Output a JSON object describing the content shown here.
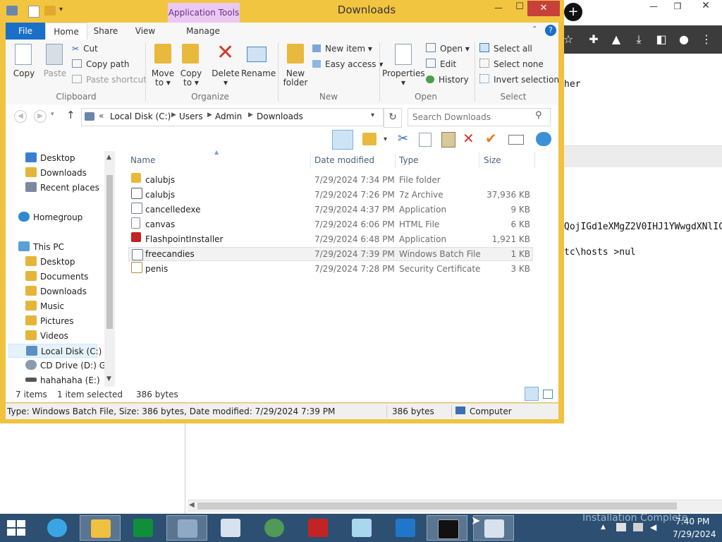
{
  "browser": {
    "code_lines": [
      "her",
      "QojIGd1eXMgZ2V0IHJ1YWwgdXNlIC",
      "tc\\hosts >nul"
    ]
  },
  "window": {
    "title": "Downloads",
    "context_tab": "Application Tools",
    "controls": {
      "minimize": "—",
      "maximize": "☐",
      "close": "✕"
    },
    "accent": "#f2c541"
  },
  "ribbon": {
    "tabs": [
      "File",
      "Home",
      "Share",
      "View",
      "Manage"
    ],
    "clipboard": {
      "copy": "Copy",
      "paste": "Paste",
      "cut": "Cut",
      "copy_path": "Copy path",
      "paste_shortcut": "Paste shortcut",
      "label": "Clipboard"
    },
    "organize": {
      "move_to": "Move\nto ▾",
      "copy_to": "Copy\nto ▾",
      "delete": "Delete\n▾",
      "rename": "Rename",
      "label": "Organize"
    },
    "new": {
      "new_folder": "New\nfolder",
      "new_item": "New item ▾",
      "easy_access": "Easy access ▾",
      "label": "New"
    },
    "open": {
      "properties": "Properties\n▾",
      "open": "Open ▾",
      "edit": "Edit",
      "history": "History",
      "label": "Open"
    },
    "select": {
      "select_all": "Select all",
      "select_none": "Select none",
      "invert": "Invert selection",
      "label": "Select"
    }
  },
  "address": {
    "prefix": "«",
    "crumbs": [
      "Local Disk (C:)",
      "Users",
      "Admin",
      "Downloads"
    ],
    "search_placeholder": "Search Downloads"
  },
  "nav": {
    "items": [
      {
        "label": "Desktop",
        "color": "#3b7fd1"
      },
      {
        "label": "Downloads",
        "color": "#e5b53a"
      },
      {
        "label": "Recent places",
        "color": "#7b8aa0"
      },
      {
        "label": "Homegroup",
        "color": "#2f8bd0"
      },
      {
        "label": "This PC",
        "color": "#5a9fd6"
      },
      {
        "label": "Desktop",
        "color": "#e5b53a"
      },
      {
        "label": "Documents",
        "color": "#e5b53a"
      },
      {
        "label": "Downloads",
        "color": "#e5b53a"
      },
      {
        "label": "Music",
        "color": "#e5b53a"
      },
      {
        "label": "Pictures",
        "color": "#e5b53a"
      },
      {
        "label": "Videos",
        "color": "#e5b53a"
      },
      {
        "label": "Local Disk (C:)",
        "color": "#5c8fc2"
      },
      {
        "label": "CD Drive (D:) GRI",
        "color": "#8a9bb0"
      },
      {
        "label": "hahahaha (E:)",
        "color": "#555555"
      }
    ]
  },
  "columns": {
    "name": "Name",
    "date": "Date modified",
    "type": "Type",
    "size": "Size"
  },
  "files": [
    {
      "name": "calubjs",
      "date": "7/29/2024 7:34 PM",
      "type": "File folder",
      "size": "",
      "color": "#e8b93c"
    },
    {
      "name": "calubjs",
      "date": "7/29/2024 7:26 PM",
      "type": "7z Archive",
      "size": "37,936 KB",
      "color": "#5a5a5a"
    },
    {
      "name": "cancelledexe",
      "date": "7/29/2024 4:37 PM",
      "type": "Application",
      "size": "9 KB",
      "color": "#6c7f97"
    },
    {
      "name": "canvas",
      "date": "7/29/2024 6:06 PM",
      "type": "HTML File",
      "size": "6 KB",
      "color": "#8a8a8a"
    },
    {
      "name": "FlashpointInstaller",
      "date": "7/29/2024 6:48 PM",
      "type": "Application",
      "size": "1,921 KB",
      "color": "#c42323"
    },
    {
      "name": "freecandies",
      "date": "7/29/2024 7:39 PM",
      "type": "Windows Batch File",
      "size": "1 KB",
      "color": "#6b7c90"
    },
    {
      "name": "penis",
      "date": "7/29/2024 7:28 PM",
      "type": "Security Certificate",
      "size": "3 KB",
      "color": "#b28a3a"
    }
  ],
  "status": {
    "item_count": "7 items",
    "selected": "1 item selected",
    "selected_size": "386 bytes",
    "details": "Type: Windows Batch File, Size: 386 bytes, Date modified: 7/29/2024 7:39 PM",
    "size": "386 bytes",
    "location": "Computer"
  },
  "taskbar": {
    "overlay": "Installation Complete",
    "time": "7:40 PM",
    "date": "7/29/2024",
    "color": "#2c4f72"
  }
}
